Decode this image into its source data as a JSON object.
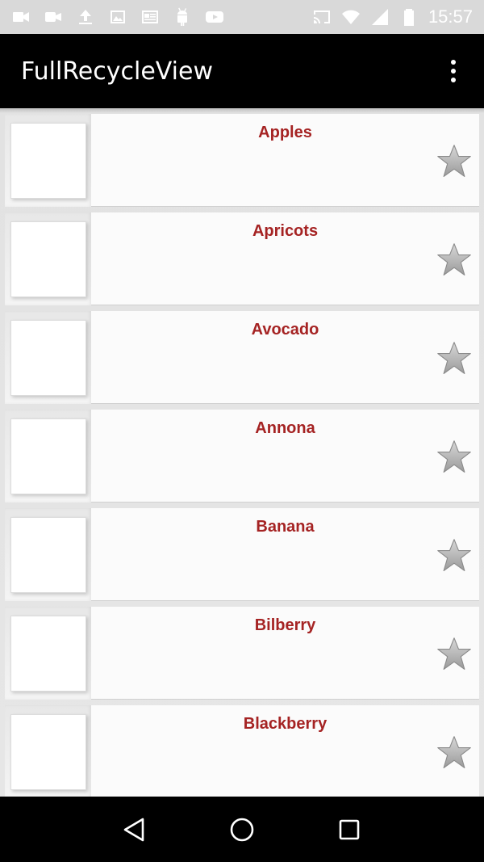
{
  "status_bar": {
    "time": "15:57",
    "icons_left": [
      "video-icon",
      "videocam-icon",
      "upload-icon",
      "image-icon",
      "news-icon",
      "android-icon",
      "youtube-icon"
    ],
    "icons_right": [
      "cast-icon",
      "wifi-icon",
      "signal-icon",
      "battery-icon"
    ]
  },
  "app_bar": {
    "title": "FullRecycleView",
    "menu_icon": "overflow-menu-icon"
  },
  "list": {
    "items": [
      {
        "label": "Apples"
      },
      {
        "label": "Apricots"
      },
      {
        "label": "Avocado"
      },
      {
        "label": "Annona"
      },
      {
        "label": "Banana"
      },
      {
        "label": "Bilberry"
      },
      {
        "label": "Blackberry"
      }
    ]
  },
  "nav_bar": {
    "back": "back-icon",
    "home": "home-icon",
    "recents": "recents-icon"
  },
  "colors": {
    "title_text": "#a52323",
    "app_bar_bg": "#000000",
    "status_bar_bg": "#d9d9d9"
  }
}
